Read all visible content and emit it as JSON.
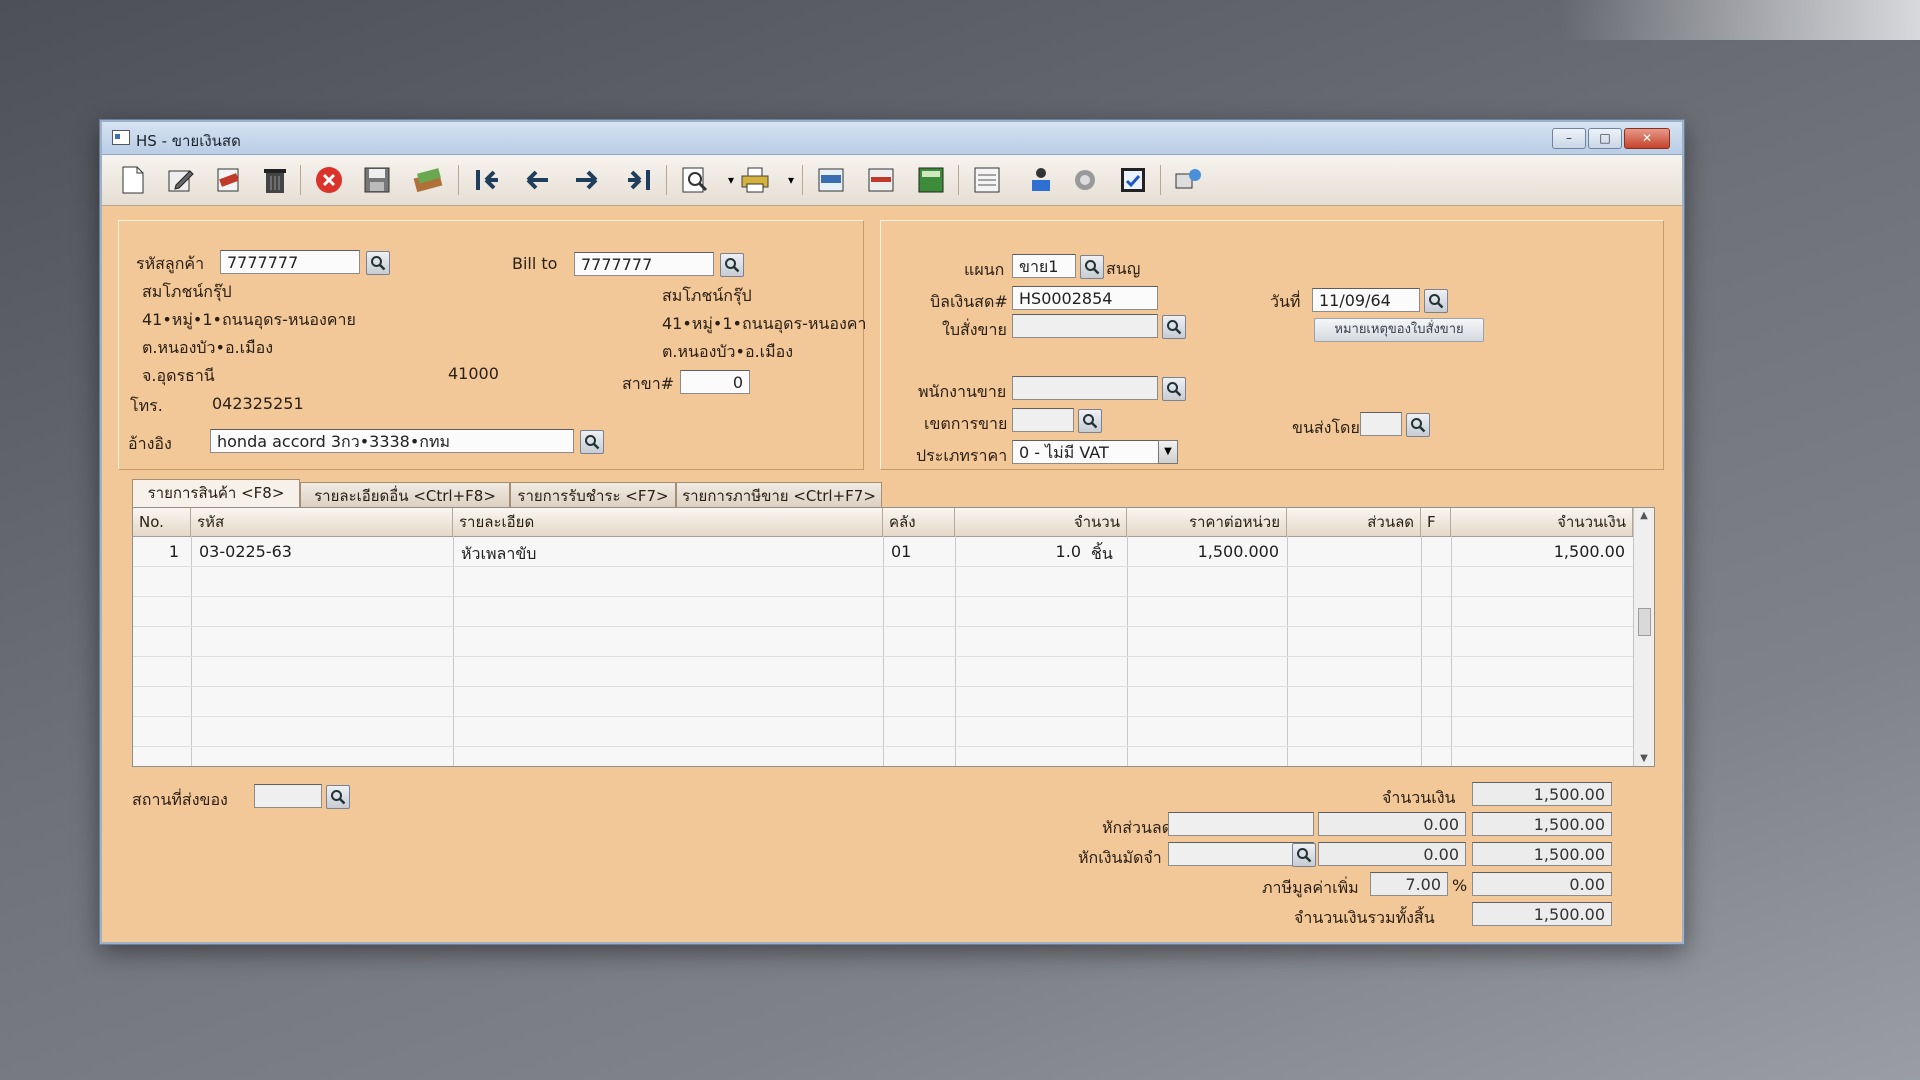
{
  "window": {
    "title": "HS - ขายเงินสด",
    "buttons": {
      "minimize": "–",
      "maximize": "□",
      "close": "✕"
    }
  },
  "toolbar": {
    "icons": [
      "new-doc-icon",
      "edit-icon",
      "cancel-doc-icon",
      "delete-icon",
      "close-icon",
      "save-icon",
      "refresh-icon",
      "first-record-icon",
      "prev-record-icon",
      "next-record-icon",
      "last-record-icon",
      "preview-icon",
      "print-icon",
      "note-icon",
      "form-icon",
      "calc-icon",
      "report-icon",
      "approve-icon",
      "check-icon",
      "confirm-icon",
      "network-icon"
    ]
  },
  "customer": {
    "code_label": "รหัสลูกค้า",
    "code_value": "7777777",
    "name": "สมโภชน์กรุ๊ป",
    "address1": "41•หมู่•1•ถนนอุดร-หนองคาย",
    "address2": "ต.หนองบัว•อ.เมือง",
    "province": "จ.อุดรธานี",
    "postcode": "41000",
    "phone_label": "โทร.",
    "phone": "042325251",
    "ref_label": "อ้างอิง",
    "ref_value": "honda accord 3กว•3338•กทม"
  },
  "bill_to": {
    "label": "Bill to",
    "value": "7777777",
    "name": "สมโภชน์กรุ๊ป",
    "address1": "41•หมู่•1•ถนนอุดร-หนองคา",
    "address2": "ต.หนองบัว•อ.เมือง",
    "branch_label": "สาขา#",
    "branch_value": "0"
  },
  "doc": {
    "dept_label": "แผนก",
    "dept_value": "ขาย1",
    "dept_name": "สนญ",
    "bill_label": "บิลเงินสด#",
    "bill_value": "HS0002854",
    "date_label": "วันที่",
    "date_value": "11/09/64",
    "order_label": "ใบสั่งขาย",
    "order_value": "",
    "order_note_button": "หมายเหตุของใบสั่งขาย",
    "salesman_label": "พนักงานขาย",
    "salesman_value": "",
    "zone_label": "เขตการขาย",
    "zone_value": "",
    "ship_by_label": "ขนส่งโดย",
    "ship_by_value": "",
    "price_type_label": "ประเภทราคา",
    "price_type_value": "0 - ไม่มี VAT"
  },
  "tabs": [
    {
      "label": "รายการสินค้า <F8>"
    },
    {
      "label": "รายละเอียดอื่น <Ctrl+F8>"
    },
    {
      "label": "รายการรับชำระ <F7>"
    },
    {
      "label": "รายการภาษีขาย <Ctrl+F7>"
    }
  ],
  "grid": {
    "headers": [
      "No.",
      "รหัส",
      "รายละเอียด",
      "คลัง",
      "จำนวน",
      "ราคาต่อหน่วย",
      "ส่วนลด",
      "F",
      "จำนวนเงิน"
    ],
    "rows": [
      {
        "no": "1",
        "code": "03-0225-63",
        "desc": "หัวเพลาขับ",
        "wh": "01",
        "qty": "1.0",
        "unit": "ชิ้น",
        "price": "1,500.000",
        "disc": "",
        "f": "",
        "amount": "1,500.00"
      }
    ]
  },
  "footer": {
    "ship_place_label": "สถานที่ส่งของ",
    "ship_place_value": "",
    "amount_label": "จำนวนเงิน",
    "amount_value": "1,500.00",
    "discount_label": "หักส่วนลด",
    "discount_text": "",
    "discount_amt": "0.00",
    "discount_total": "1,500.00",
    "deposit_label": "หักเงินมัดจำ",
    "deposit_text": "",
    "deposit_amt": "0.00",
    "deposit_total": "1,500.00",
    "vat_label": "ภาษีมูลค่าเพิ่ม",
    "vat_rate": "7.00",
    "vat_pct": "%",
    "vat_amount": "0.00",
    "grand_total_label": "จำนวนเงินรวมทั้งสิ้น",
    "grand_total_value": "1,500.00"
  }
}
